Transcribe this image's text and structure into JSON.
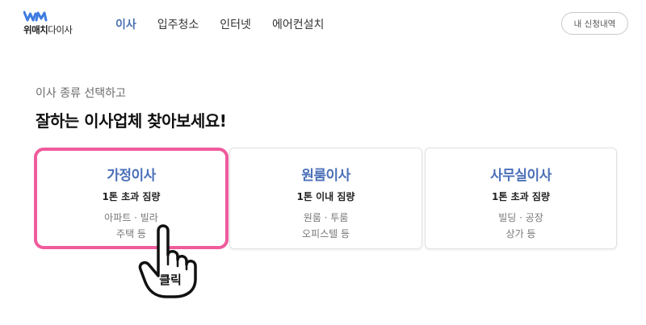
{
  "logo": {
    "text_bold": "위매치",
    "text_light": "다이사"
  },
  "nav": {
    "items": [
      {
        "label": "이사",
        "active": true
      },
      {
        "label": "입주청소",
        "active": false
      },
      {
        "label": "인터넷",
        "active": false
      },
      {
        "label": "에어컨설치",
        "active": false
      }
    ]
  },
  "header": {
    "history_button": "내 신청내역"
  },
  "main": {
    "subtitle": "이사 종류 선택하고",
    "title": "잘하는 이사업체 찾아보세요!"
  },
  "cards": [
    {
      "name": "가정이사",
      "spec": "1톤 초과 짐량",
      "desc_line1": "아파트 · 빌라",
      "desc_line2": "주택 등"
    },
    {
      "name": "원룸이사",
      "spec": "1톤 이내 짐량",
      "desc_line1": "원룸 · 투룸",
      "desc_line2": "오피스텔 등"
    },
    {
      "name": "사무실이사",
      "spec": "1톤 초과 짐량",
      "desc_line1": "빌딩 · 공장",
      "desc_line2": "상가 등"
    }
  ],
  "annotation": {
    "click_label": "클릭",
    "highlight_color": "#ef5b9c"
  },
  "colors": {
    "accent": "#4a70b8",
    "logo": "#3d7be0"
  }
}
